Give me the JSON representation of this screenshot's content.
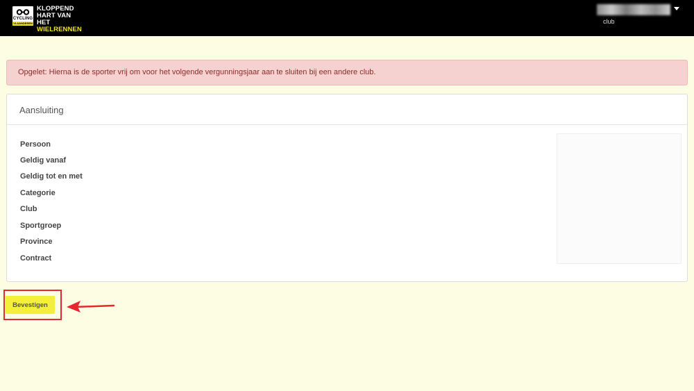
{
  "header": {
    "logo": {
      "badge_word": "CYCLING",
      "badge_sub": "VLAANDEREN",
      "line1": "KLOPPEND",
      "line2": "HART VAN HET",
      "line3": "WIELRENNEN"
    },
    "user": {
      "name": "",
      "role": "club"
    }
  },
  "alert": {
    "message": "Opgelet: Hierna is de sporter vrij om voor het volgende vergunningsjaar aan te sluiten bij een andere club."
  },
  "panel": {
    "title": "Aansluiting",
    "fields": [
      {
        "label": "Persoon",
        "value": ""
      },
      {
        "label": "Geldig vanaf",
        "value": ""
      },
      {
        "label": "Geldig tot en met",
        "value": ""
      },
      {
        "label": "Categorie",
        "value": ""
      },
      {
        "label": "Club",
        "value": ""
      },
      {
        "label": "Sportgroep",
        "value": ""
      },
      {
        "label": "Province",
        "value": ""
      },
      {
        "label": "Contract",
        "value": ""
      }
    ]
  },
  "actions": {
    "confirm_label": "Bevestigen"
  },
  "colors": {
    "background": "#fdfde4",
    "topbar": "#000000",
    "brand_yellow": "#f4e521",
    "button_yellow": "#f4ef3a",
    "alert_bg": "#f5d1cf",
    "alert_text": "#8f2b2b",
    "highlight_red": "#e5282e"
  }
}
